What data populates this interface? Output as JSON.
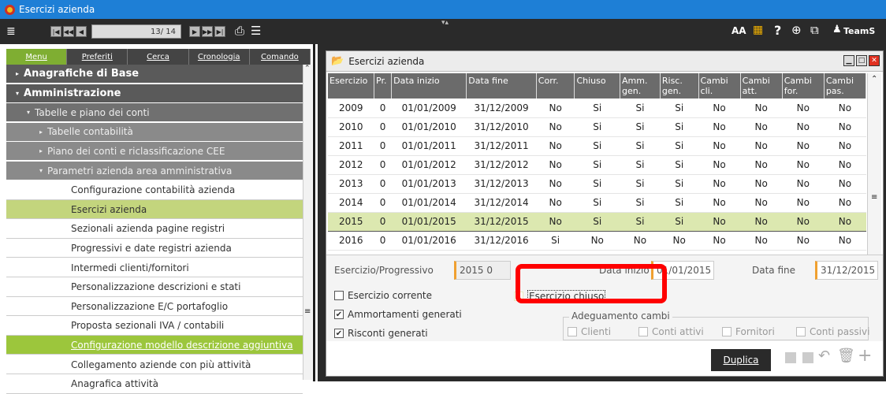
{
  "window": {
    "title": "Esercizi azienda"
  },
  "toolbar": {
    "record_pos": "13/ 14",
    "team_label": "TeamS"
  },
  "left": {
    "tabs": [
      "Menu",
      "Preferiti",
      "Cerca",
      "Cronologia",
      "Comando"
    ],
    "items": [
      {
        "label": "Anagrafiche di Base",
        "level": 0,
        "arrow": "▸"
      },
      {
        "label": "Amministrazione",
        "level": 0,
        "arrow": "▾"
      },
      {
        "label": "Tabelle e piano dei conti",
        "level": 1,
        "arrow": "▾"
      },
      {
        "label": "Tabelle  contabilità",
        "level": 2,
        "arrow": "▸"
      },
      {
        "label": "Piano dei conti e riclassificazione CEE",
        "level": 2,
        "arrow": "▸"
      },
      {
        "label": "Parametri azienda area amministrativa",
        "level": 2,
        "arrow": "▾"
      },
      {
        "label": "Configurazione contabilità azienda",
        "level": 3
      },
      {
        "label": "Esercizi azienda",
        "level": 3,
        "state": "sel"
      },
      {
        "label": "Sezionali azienda pagine registri",
        "level": 3
      },
      {
        "label": "Progressivi e date registri azienda",
        "level": 3
      },
      {
        "label": "Intermedi clienti/fornitori",
        "level": 3
      },
      {
        "label": "Personalizzazione descrizioni e stati",
        "level": 3
      },
      {
        "label": "Personalizzazione E/C portafoglio",
        "level": 3
      },
      {
        "label": "Proposta sezionali IVA / contabili",
        "level": 3
      },
      {
        "label": "Configurazione modello descrizione aggiuntiva",
        "level": 3,
        "state": "sel2"
      },
      {
        "label": "Collegamento aziende con più attività",
        "level": 3
      },
      {
        "label": "Anagrafica attività",
        "level": 3
      }
    ]
  },
  "inner": {
    "title": "Esercizi azienda"
  },
  "grid": {
    "headers": [
      "Esercizio",
      "Pr.",
      "Data inizio",
      "Data fine",
      "Corr.",
      "Chiuso",
      "Amm.\ngen.",
      "Risc.\ngen.",
      "Cambi\ncli.",
      "Cambi\natt.",
      "Cambi\nfor.",
      "Cambi\npas."
    ],
    "rows": [
      [
        "2009",
        "0",
        "01/01/2009",
        "31/12/2009",
        "No",
        "Si",
        "Si",
        "Si",
        "No",
        "No",
        "No",
        "No"
      ],
      [
        "2010",
        "0",
        "01/01/2010",
        "31/12/2010",
        "No",
        "Si",
        "Si",
        "Si",
        "No",
        "No",
        "No",
        "No"
      ],
      [
        "2011",
        "0",
        "01/01/2011",
        "31/12/2011",
        "No",
        "Si",
        "Si",
        "Si",
        "No",
        "No",
        "No",
        "No"
      ],
      [
        "2012",
        "0",
        "01/01/2012",
        "31/12/2012",
        "No",
        "Si",
        "Si",
        "Si",
        "No",
        "No",
        "No",
        "No"
      ],
      [
        "2013",
        "0",
        "01/01/2013",
        "31/12/2013",
        "No",
        "Si",
        "Si",
        "Si",
        "No",
        "No",
        "No",
        "No"
      ],
      [
        "2014",
        "0",
        "01/01/2014",
        "31/12/2014",
        "No",
        "Si",
        "Si",
        "Si",
        "No",
        "No",
        "No",
        "No"
      ],
      [
        "2015",
        "0",
        "01/01/2015",
        "31/12/2015",
        "No",
        "Si",
        "Si",
        "Si",
        "No",
        "No",
        "No",
        "No"
      ],
      [
        "2016",
        "0",
        "01/01/2016",
        "31/12/2016",
        "Si",
        "No",
        "No",
        "No",
        "No",
        "No",
        "No",
        "No"
      ]
    ],
    "selected_row": 6
  },
  "form": {
    "esercizio_label": "Esercizio/Progressivo",
    "esercizio_value": "2015  0",
    "data_inizio_label": "Data inizio",
    "data_inizio_value": "01/01/2015",
    "data_fine_label": "Data fine",
    "data_fine_value": "31/12/2015",
    "esercizio_corrente": "Esercizio corrente",
    "esercizio_chiuso": "Esercizio chiuso",
    "ammortamenti": "Ammortamenti generati",
    "risconti": "Risconti generati",
    "adeguamento": "Adeguamento cambi",
    "clienti": "Clienti",
    "conti_attivi": "Conti attivi",
    "fornitori": "Fornitori",
    "conti_passivi": "Conti passivi"
  },
  "actions": {
    "duplica": "Duplica"
  },
  "colors": {
    "accent": "#9cc63c",
    "highlight": "#ff0000"
  }
}
